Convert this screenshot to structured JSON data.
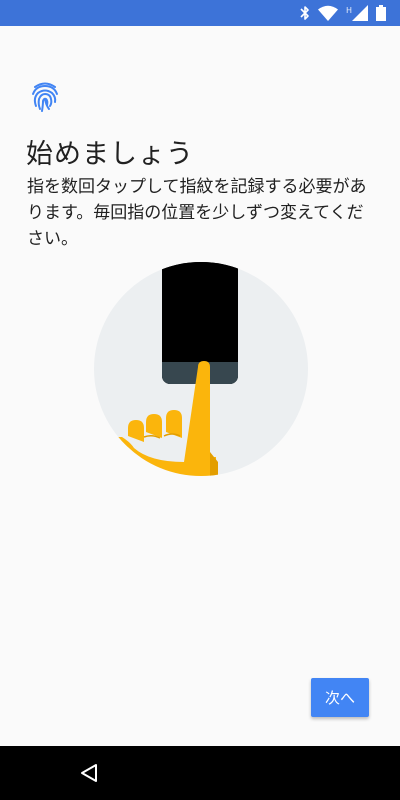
{
  "status_bar": {
    "icons": [
      "bluetooth-icon",
      "wifi-icon",
      "signal-h-icon",
      "battery-icon"
    ],
    "network_label": "H",
    "color": "#3d73d8"
  },
  "header": {
    "icon": "fingerprint-icon",
    "title": "始めましょう",
    "description": "指を数回タップして指紋を記録する必要があります。毎回指の位置を少しずつ変えてください。"
  },
  "illustration": {
    "name": "fingerprint-enrollment-illustration"
  },
  "actions": {
    "next_label": "次へ",
    "accent_color": "#4285f4"
  },
  "nav_bar": {
    "icons": [
      "back-icon"
    ]
  }
}
